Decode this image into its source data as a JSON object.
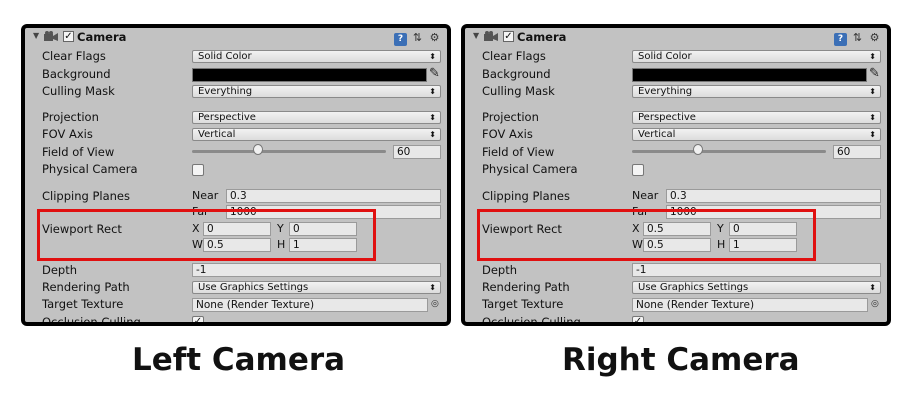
{
  "panels": [
    {
      "id": "left",
      "component_title": "Camera",
      "enabled": true,
      "clear_flags": {
        "label": "Clear Flags",
        "value": "Solid Color"
      },
      "background": {
        "label": "Background",
        "color": "#000000"
      },
      "culling_mask": {
        "label": "Culling Mask",
        "value": "Everything"
      },
      "projection": {
        "label": "Projection",
        "value": "Perspective"
      },
      "fov_axis": {
        "label": "FOV Axis",
        "value": "Vertical"
      },
      "field_of_view": {
        "label": "Field of View",
        "value": "60",
        "slider_fraction": 0.38
      },
      "physical_camera": {
        "label": "Physical Camera",
        "checked": false
      },
      "clipping_planes": {
        "label": "Clipping Planes",
        "near_label": "Near",
        "near": "0.3",
        "far_label": "Far",
        "far": "1000"
      },
      "viewport_rect": {
        "label": "Viewport Rect",
        "x_label": "X",
        "x": "0",
        "y_label": "Y",
        "y": "0",
        "w_label": "W",
        "w": "0.5",
        "h_label": "H",
        "h": "1"
      },
      "depth": {
        "label": "Depth",
        "value": "-1"
      },
      "rendering_path": {
        "label": "Rendering Path",
        "value": "Use Graphics Settings"
      },
      "target_texture": {
        "label": "Target Texture",
        "value": "None (Render Texture)"
      },
      "occlusion_culling": {
        "label": "Occlusion Culling",
        "checked": true
      },
      "caption": "Left Camera"
    },
    {
      "id": "right",
      "component_title": "Camera",
      "enabled": true,
      "clear_flags": {
        "label": "Clear Flags",
        "value": "Solid Color"
      },
      "background": {
        "label": "Background",
        "color": "#000000"
      },
      "culling_mask": {
        "label": "Culling Mask",
        "value": "Everything"
      },
      "projection": {
        "label": "Projection",
        "value": "Perspective"
      },
      "fov_axis": {
        "label": "FOV Axis",
        "value": "Vertical"
      },
      "field_of_view": {
        "label": "Field of View",
        "value": "60",
        "slider_fraction": 0.38
      },
      "physical_camera": {
        "label": "Physical Camera",
        "checked": false
      },
      "clipping_planes": {
        "label": "Clipping Planes",
        "near_label": "Near",
        "near": "0.3",
        "far_label": "Far",
        "far": "1000"
      },
      "viewport_rect": {
        "label": "Viewport Rect",
        "x_label": "X",
        "x": "0.5",
        "y_label": "Y",
        "y": "0",
        "w_label": "W",
        "w": "0.5",
        "h_label": "H",
        "h": "1"
      },
      "depth": {
        "label": "Depth",
        "value": "-1"
      },
      "rendering_path": {
        "label": "Rendering Path",
        "value": "Use Graphics Settings"
      },
      "target_texture": {
        "label": "Target Texture",
        "value": "None (Render Texture)"
      },
      "occlusion_culling": {
        "label": "Occlusion Culling",
        "checked": true
      },
      "caption": "Right Camera"
    }
  ],
  "icons": {
    "fold": "triangle-down-icon",
    "camera": "camera-icon",
    "help": "help-book-icon",
    "presets": "sliders-icon",
    "settings": "gear-icon",
    "color_picker": "eyedropper-icon",
    "object_picker": "circle-target-icon"
  },
  "colors": {
    "highlight": "#e01010",
    "inspector_bg": "#c2c2c2",
    "frame": "#000000"
  }
}
